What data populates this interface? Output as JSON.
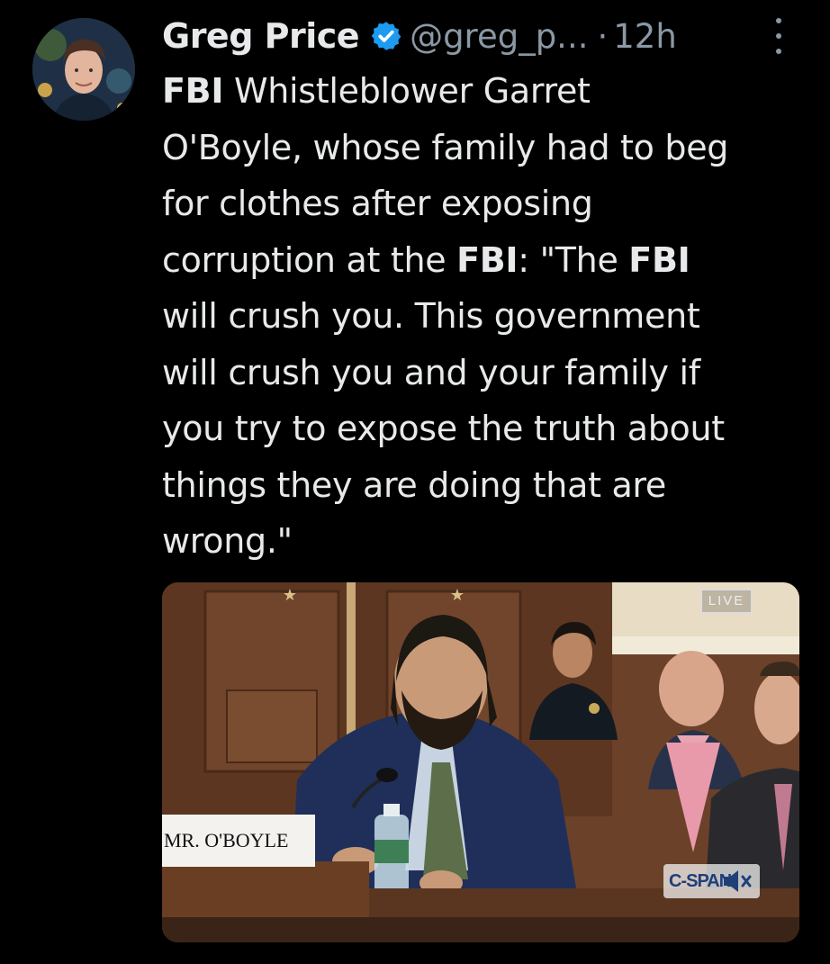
{
  "tweet": {
    "author_name": "Greg Price",
    "handle": "@greg_p...",
    "separator": "·",
    "time": "12h",
    "verified": true,
    "body_lines": [
      [
        {
          "t": "FBI",
          "b": true
        },
        {
          "t": " Whistleblower Garret",
          "b": false
        }
      ],
      [
        {
          "t": "O'Boyle, whose family had to beg",
          "b": false
        }
      ],
      [
        {
          "t": "for clothes after exposing",
          "b": false
        }
      ],
      [
        {
          "t": "corruption at the ",
          "b": false
        },
        {
          "t": "FBI",
          "b": true
        },
        {
          "t": ": \"The ",
          "b": false
        },
        {
          "t": "FBI",
          "b": true
        }
      ],
      [
        {
          "t": "will crush you. This government",
          "b": false
        }
      ],
      [
        {
          "t": "will crush you and your family if",
          "b": false
        }
      ],
      [
        {
          "t": "you try to expose the truth about",
          "b": false
        }
      ],
      [
        {
          "t": "things they are doing that are",
          "b": false
        }
      ],
      [
        {
          "t": "wrong.\"",
          "b": false
        }
      ]
    ]
  },
  "media": {
    "live_badge": "LIVE",
    "nameplate": "MR. O'BOYLE",
    "network_logo": "C-SPAN",
    "mute_icon": "speaker-muted-icon"
  },
  "colors": {
    "background": "#000000",
    "text": "#e7e9ea",
    "muted": "#8b98a5",
    "verified_blue": "#1d9bf0"
  }
}
